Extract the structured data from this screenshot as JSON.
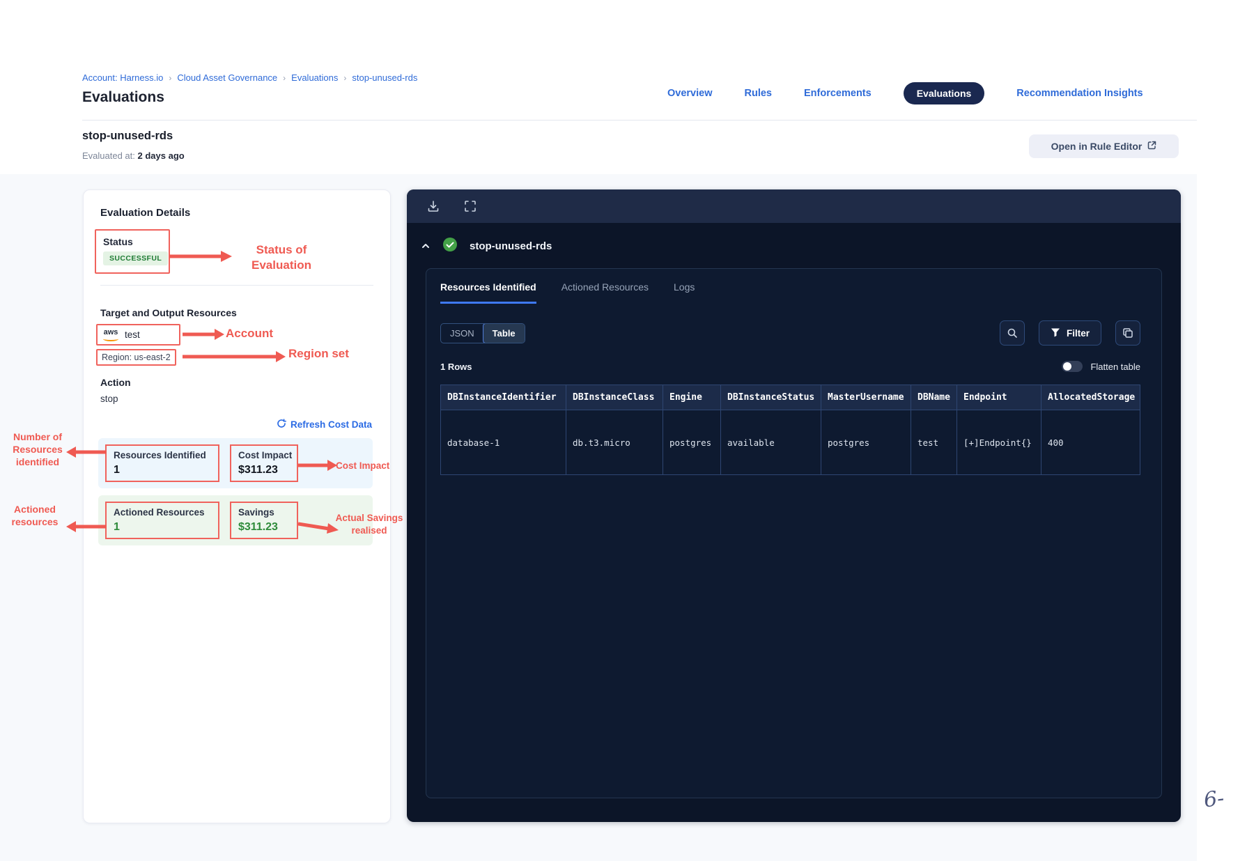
{
  "breadcrumb": {
    "separator": "›",
    "items": [
      "Account: Harness.io",
      "Cloud Asset Governance",
      "Evaluations",
      "stop-unused-rds"
    ]
  },
  "page_title": "Evaluations",
  "nav": {
    "tabs": [
      {
        "label": "Overview"
      },
      {
        "label": "Rules"
      },
      {
        "label": "Enforcements"
      },
      {
        "label": "Evaluations"
      },
      {
        "label": "Recommendation Insights"
      }
    ],
    "active": "Evaluations"
  },
  "subheader": {
    "title": "stop-unused-rds",
    "evaluated_label": "Evaluated at:",
    "evaluated_value": "2 days ago",
    "open_button": "Open in Rule Editor"
  },
  "details": {
    "heading": "Evaluation Details",
    "status_label": "Status",
    "status_value": "SUCCESSFUL",
    "target_heading": "Target and Output Resources",
    "aws_text": "aws",
    "account_name": "test",
    "region": "Region: us-east-2",
    "action_label": "Action",
    "action_value": "stop",
    "refresh_label": "Refresh Cost Data",
    "stats": {
      "resources": {
        "label": "Resources Identified",
        "value": "1"
      },
      "cost": {
        "label": "Cost Impact",
        "value": "$311.23"
      },
      "actioned": {
        "label": "Actioned Resources",
        "value": "1"
      },
      "savings": {
        "label": "Savings",
        "value": "$311.23"
      }
    }
  },
  "annotations": {
    "accent_color": "#ef5a52",
    "status": "Status of Evaluation",
    "account": "Account",
    "region": "Region set",
    "resources": "Number of Resources identified",
    "cost": "Cost Impact",
    "actioned": "Actioned resources",
    "savings": "Actual Savings realised"
  },
  "viewer": {
    "title": "stop-unused-rds",
    "tabs": [
      {
        "label": "Resources Identified",
        "active": true
      },
      {
        "label": "Actioned Resources",
        "active": false
      },
      {
        "label": "Logs",
        "active": false
      }
    ],
    "view_modes": {
      "json": "JSON",
      "table": "Table",
      "active": "Table"
    },
    "filter_label": "Filter",
    "rows_count": "1 Rows",
    "flatten_label": "Flatten table",
    "table": {
      "columns": [
        "DBInstanceIdentifier",
        "DBInstanceClass",
        "Engine",
        "DBInstanceStatus",
        "MasterUsername",
        "DBName",
        "Endpoint",
        "AllocatedStorage"
      ],
      "rows": [
        [
          "database-1",
          "db.t3.micro",
          "postgres",
          "available",
          "postgres",
          "test",
          "[+]Endpoint{}",
          "400"
        ]
      ]
    }
  },
  "watermark": "6-"
}
